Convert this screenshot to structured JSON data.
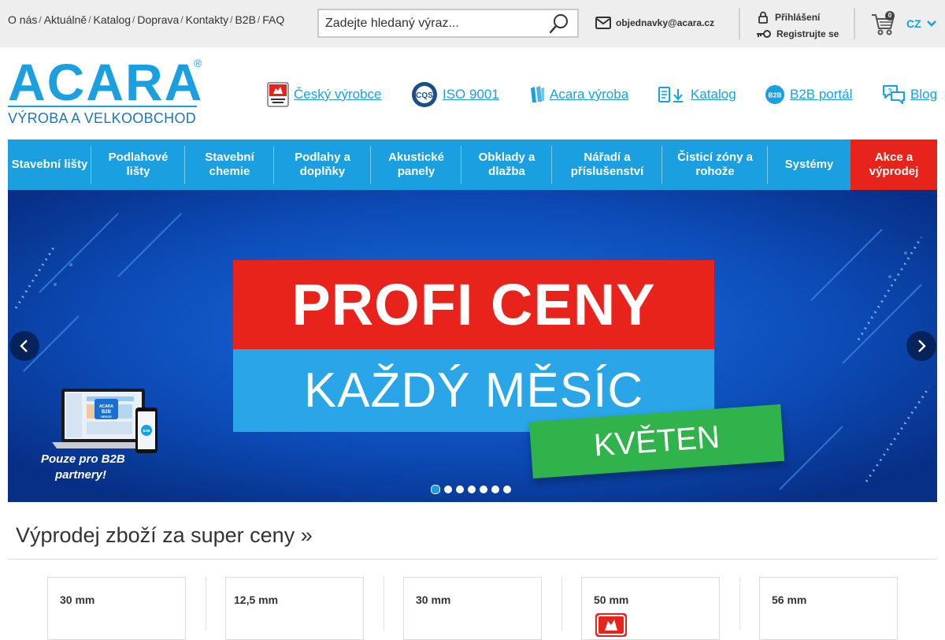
{
  "top_links": [
    "O nás",
    "Aktuálně",
    "Katalog",
    "Doprava",
    "Kontakty",
    "B2B",
    "FAQ"
  ],
  "search": {
    "placeholder": "Zadejte hledaný výraz..."
  },
  "email": "objednavky@acara.cz",
  "account": {
    "login": "Přihlášení",
    "register": "Registrujte se"
  },
  "cart": {
    "count": "0"
  },
  "language": "CZ",
  "logo": {
    "name": "ACARA",
    "registered": "®",
    "tagline": "VÝROBA A VELKOOBCHOD"
  },
  "header_links": [
    {
      "label": "Český výrobce",
      "icon": "czech-producer-badge-icon"
    },
    {
      "label": "ISO 9001",
      "icon": "cqs-iso-icon"
    },
    {
      "label": "Acara výroba",
      "icon": "production-icon"
    },
    {
      "label": "Katalog",
      "icon": "catalog-download-icon"
    },
    {
      "label": "B2B portál",
      "icon": "b2b-icon"
    },
    {
      "label": "Blog",
      "icon": "blog-chat-icon"
    }
  ],
  "nav": [
    {
      "label": "Stavební lišty"
    },
    {
      "label": "Podlahové lišty"
    },
    {
      "label": "Stavební chemie"
    },
    {
      "label": "Podlahy a doplňky"
    },
    {
      "label": "Akustické panely"
    },
    {
      "label": "Obklady a dlažba"
    },
    {
      "label": "Nářadí a příslušenství"
    },
    {
      "label": "Čisticí zóny a rohože"
    },
    {
      "label": "Systémy"
    },
    {
      "label": "Akce a výprodej"
    }
  ],
  "banner": {
    "headline": "PROFI CENY",
    "subline": "KAŽDÝ MĚSÍC",
    "month": "KVĚTEN",
    "b2b_note_1": "Pouze pro B2B",
    "b2b_note_2": "partnery!",
    "screen_label": "ACARA B2B SEKCE",
    "phone_label": "B2B",
    "slides": 7,
    "active_slide": 1
  },
  "section": {
    "title": "Výprodej zboží za super ceny »"
  },
  "products": [
    {
      "size": "30 mm"
    },
    {
      "size": "12,5 mm"
    },
    {
      "size": "30 mm"
    },
    {
      "size": "50 mm",
      "badge": "czech-producer-badge-icon"
    },
    {
      "size": "56 mm"
    }
  ],
  "colors": {
    "brand_blue": "#1aa0e0",
    "sale_red": "#e8231c",
    "top_bar": "#eeeeee",
    "banner_green": "#2fb34a"
  }
}
